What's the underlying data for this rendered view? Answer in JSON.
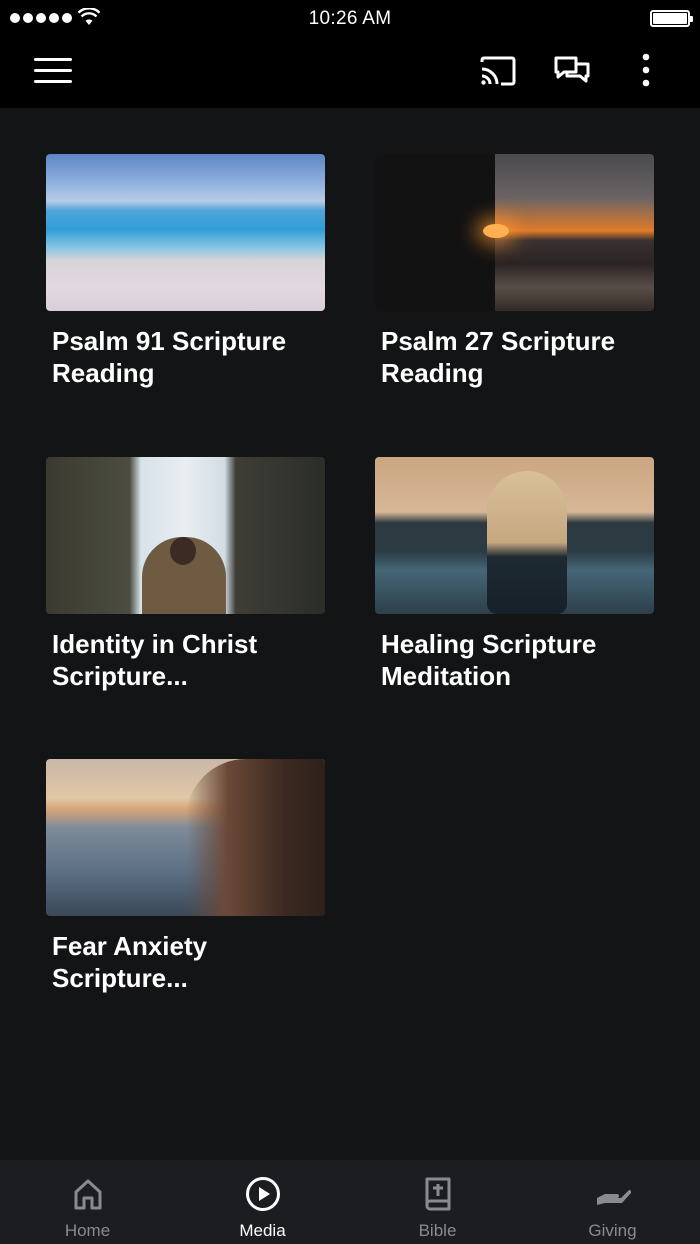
{
  "status_bar": {
    "time": "10:26 AM"
  },
  "header": {
    "menu_icon": "hamburger-menu-icon",
    "actions": [
      {
        "icon": "cast-icon"
      },
      {
        "icon": "chat-icon"
      },
      {
        "icon": "more-vertical-icon"
      }
    ]
  },
  "media": {
    "items": [
      {
        "title": "Psalm 91 Scripture Reading",
        "thumbnail": "ocean beach"
      },
      {
        "title": "Psalm 27 Scripture Reading",
        "thumbnail": "sunset shore"
      },
      {
        "title": "Identity in Christ Scripture...",
        "thumbnail": "waterfall person"
      },
      {
        "title": "Healing Scripture Meditation",
        "thumbnail": "woman lake dusk"
      },
      {
        "title": "Fear Anxiety Scripture...",
        "thumbnail": "sunset sea hair"
      }
    ]
  },
  "bottom_nav": {
    "items": [
      {
        "label": "Home",
        "icon": "home-icon",
        "active": false
      },
      {
        "label": "Media",
        "icon": "play-circle-icon",
        "active": true
      },
      {
        "label": "Bible",
        "icon": "bible-icon",
        "active": false
      },
      {
        "label": "Giving",
        "icon": "giving-hand-icon",
        "active": false
      }
    ]
  },
  "colors": {
    "background": "#131416",
    "header": "#000000",
    "nav_background": "#1c1d20",
    "nav_inactive": "#8a8b8e",
    "nav_active": "#ffffff"
  }
}
